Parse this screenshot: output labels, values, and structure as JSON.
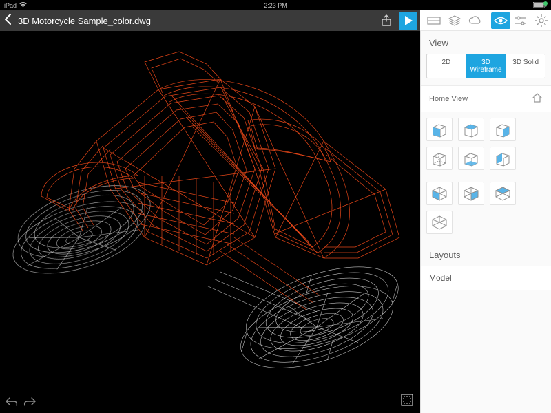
{
  "status": {
    "device": "iPad",
    "time": "2:23 PM",
    "battery_pct": 100
  },
  "titlebar": {
    "filename": "3D Motorcycle Sample_color.dwg"
  },
  "sidebar": {
    "view_title": "View",
    "tabs": {
      "d2": "2D",
      "wire": "3D Wireframe",
      "solid": "3D Solid"
    },
    "home_view": "Home View",
    "layouts_title": "Layouts",
    "layout_model": "Model"
  },
  "colors": {
    "accent": "#1ea5e0",
    "wire_primary": "#f04a1a",
    "wire_secondary": "#d6d6d6"
  }
}
